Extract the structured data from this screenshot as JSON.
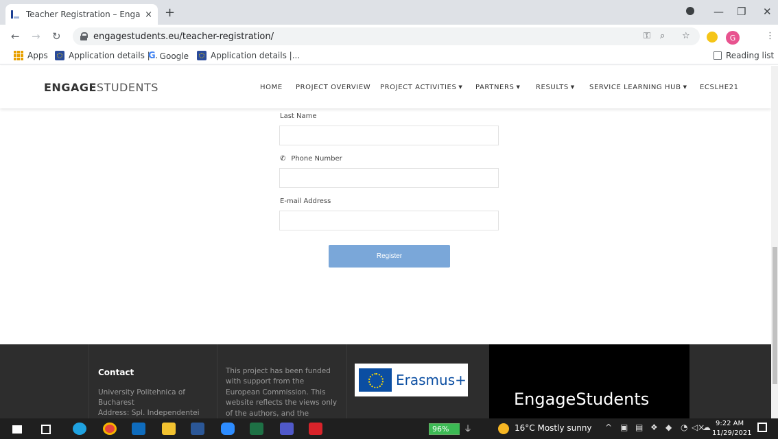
{
  "browser": {
    "tab_title": "Teacher Registration – EngageStu",
    "tab_close": "×",
    "new_tab": "+",
    "url": "engagestudents.eu/teacher-registration/",
    "profile_initial": "G",
    "window_controls": {
      "minimize": "—",
      "maximize": "❐",
      "close": "✕"
    },
    "bookmarks": [
      {
        "label": "Apps",
        "icon": "apps-grid-icon"
      },
      {
        "label": "Application details |...",
        "icon": "eu-flag-icon"
      },
      {
        "label": "Google",
        "icon": "google-icon"
      },
      {
        "label": "Application details |...",
        "icon": "eu-flag-icon"
      }
    ],
    "reading_list": "Reading list"
  },
  "site": {
    "logo_bold": "ENGAGE",
    "logo_light": "STUDENTS",
    "nav": [
      {
        "label": "HOME",
        "dropdown": false
      },
      {
        "label": "PROJECT OVERVIEW",
        "dropdown": false
      },
      {
        "label": "PROJECT ACTIVITIES",
        "dropdown": true
      },
      {
        "label": "PARTNERS",
        "dropdown": true
      },
      {
        "label": "RESULTS",
        "dropdown": true
      },
      {
        "label": "SERVICE LEARNING HUB",
        "dropdown": true
      },
      {
        "label": "ECSLHE21",
        "dropdown": false
      }
    ]
  },
  "form": {
    "last_name_label": "Last Name",
    "last_name_value": "",
    "phone_label": "Phone Number",
    "phone_value": "",
    "email_label": "E-mail Address",
    "email_value": "",
    "register_label": "Register"
  },
  "footer": {
    "contact_title": "Contact",
    "contact_lines": [
      "University Politehnica of",
      "Bucharest",
      "Address: Spl. Independentei"
    ],
    "funding_lines": [
      "This project has been funded",
      "with support from the",
      "European Commission. This",
      "website reflects the views only",
      "of the authors, and the"
    ],
    "erasmus_text": "Erasmus+",
    "brand": "EngageStudents"
  },
  "taskbar": {
    "battery": "96%",
    "weather": "16°C  Mostly sunny",
    "time": "9:22 AM",
    "date": "11/29/2021"
  },
  "colors": {
    "register_button": "#7aa7d9",
    "footer_bg": "#2d2d2d",
    "taskbar_bg": "#1f1f1f"
  }
}
